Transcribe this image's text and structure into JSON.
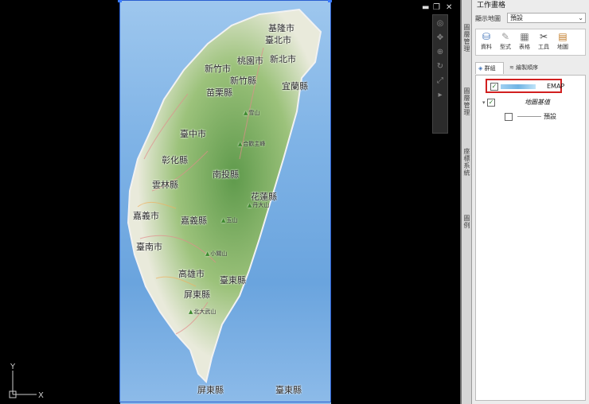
{
  "window": {
    "controls": [
      "minimize-icon",
      "restore-icon",
      "close-icon"
    ]
  },
  "map": {
    "labels": [
      {
        "name": "基隆市"
      },
      {
        "name": "臺北市"
      },
      {
        "name": "桃園市"
      },
      {
        "name": "新北市"
      },
      {
        "name": "新竹市"
      },
      {
        "name": "新竹縣"
      },
      {
        "name": "宜蘭縣"
      },
      {
        "name": "苗栗縣"
      },
      {
        "name": "臺中市"
      },
      {
        "name": "彰化縣"
      },
      {
        "name": "南投縣"
      },
      {
        "name": "雲林縣"
      },
      {
        "name": "花蓮縣"
      },
      {
        "name": "嘉義市"
      },
      {
        "name": "嘉義縣"
      },
      {
        "name": "臺南市"
      },
      {
        "name": "高雄市"
      },
      {
        "name": "臺東縣"
      },
      {
        "name": "屏東縣"
      },
      {
        "name": "屏東縣"
      },
      {
        "name": "臺東縣"
      }
    ],
    "mountains": [
      {
        "name": "雪山"
      },
      {
        "name": "合歡主峰"
      },
      {
        "name": "丹大山"
      },
      {
        "name": "玉山"
      },
      {
        "name": "小關山"
      },
      {
        "name": "北大武山"
      }
    ]
  },
  "axis": {
    "y": "Y",
    "x": "X"
  },
  "panel": {
    "title": "工作畫格",
    "display_label": "顯示地圖",
    "display_value": "預設",
    "side_tabs": [
      "圖層管理",
      "圖層管理",
      "座標系統",
      "圖例"
    ],
    "tools": [
      {
        "label": "資料",
        "icon": "database-icon"
      },
      {
        "label": "型式",
        "icon": "brush-icon"
      },
      {
        "label": "表格",
        "icon": "table-icon"
      },
      {
        "label": "工具",
        "icon": "tools-icon"
      },
      {
        "label": "地圖",
        "icon": "map-icon"
      }
    ],
    "tabs": [
      {
        "label": "群組",
        "icon": "layer-group-icon"
      },
      {
        "label": "繪製順序",
        "icon": "draw-order-icon"
      }
    ],
    "tree": {
      "emap": {
        "label": "EMAP",
        "checked": true
      },
      "base_layer": {
        "label": "地圖基值",
        "checked": true
      },
      "default": {
        "label": "預設",
        "checked": false
      }
    }
  }
}
